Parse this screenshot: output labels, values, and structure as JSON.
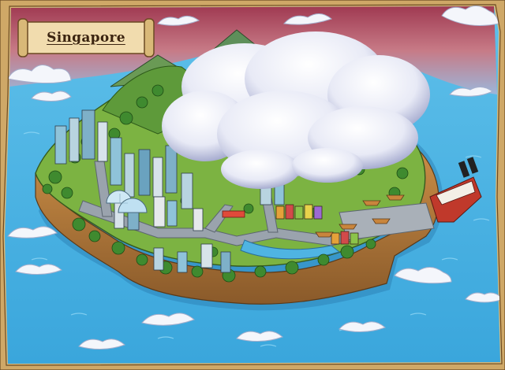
{
  "map": {
    "region_name": "Singapore"
  },
  "colors": {
    "ocean": "#4fb4e2",
    "ocean_deep": "#2e8fc8",
    "parchment": "#e9cf99",
    "sky_top": "#b4475c",
    "sky_bottom": "#9fb4d8",
    "grass": "#7cb342",
    "cliff": "#b07a3c",
    "ship_hull": "#c0392b"
  },
  "icons": {
    "title": "scroll-banner-icon",
    "ship": "cruise-ship-icon",
    "domes": "glass-dome-icon"
  }
}
